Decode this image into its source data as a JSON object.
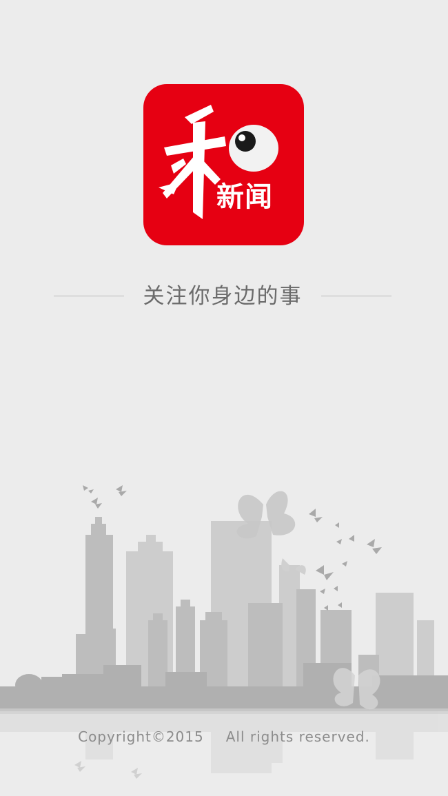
{
  "app": {
    "logo_text": "新闻",
    "logo_glyph": "和",
    "brand_color": "#e60012"
  },
  "tagline": "关注你身边的事",
  "copyright": {
    "left": "Copyright©2015",
    "right": "All rights reserved."
  },
  "colors": {
    "background": "#ececec",
    "skyline_dark": "#b4b4b4",
    "skyline_light": "#cbcbcb",
    "text_gray": "#6b6b6b"
  }
}
